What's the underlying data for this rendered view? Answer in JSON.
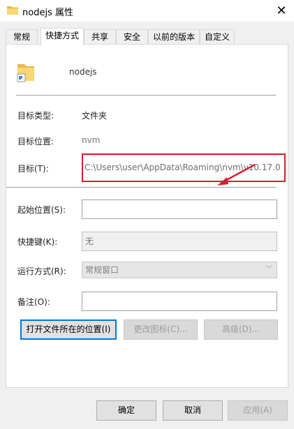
{
  "window": {
    "title": "nodejs 属性",
    "close_glyph": "✕"
  },
  "tabs": [
    {
      "label": "常规",
      "active": false
    },
    {
      "label": "快捷方式",
      "active": true
    },
    {
      "label": "共享",
      "active": false
    },
    {
      "label": "安全",
      "active": false
    },
    {
      "label": "以前的版本",
      "active": false
    },
    {
      "label": "自定义",
      "active": false
    }
  ],
  "shortcut": {
    "name": "nodejs",
    "target_type_label": "目标类型:",
    "target_type_value": "文件夹",
    "target_location_label": "目标位置:",
    "target_location_value": "nvm",
    "target_label": "目标(T):",
    "target_value": "C:\\Users\\user\\AppData\\Roaming\\nvm\\v10.17.0",
    "start_in_label": "起始位置(S):",
    "start_in_value": "",
    "hotkey_label": "快捷键(K):",
    "hotkey_value": "无",
    "run_label": "运行方式(R):",
    "run_value": "常规窗口",
    "comment_label": "备注(O):",
    "comment_value": "",
    "open_location_button": "打开文件所在的位置(I)",
    "change_icon_button": "更改图标(C)...",
    "advanced_button": "高级(D)..."
  },
  "footer": {
    "ok": "确定",
    "cancel": "取消",
    "apply": "应用(A)"
  },
  "colors": {
    "highlight_box": "#d51f2e",
    "arrow": "#d51f2e",
    "focus": "#0078d7"
  }
}
